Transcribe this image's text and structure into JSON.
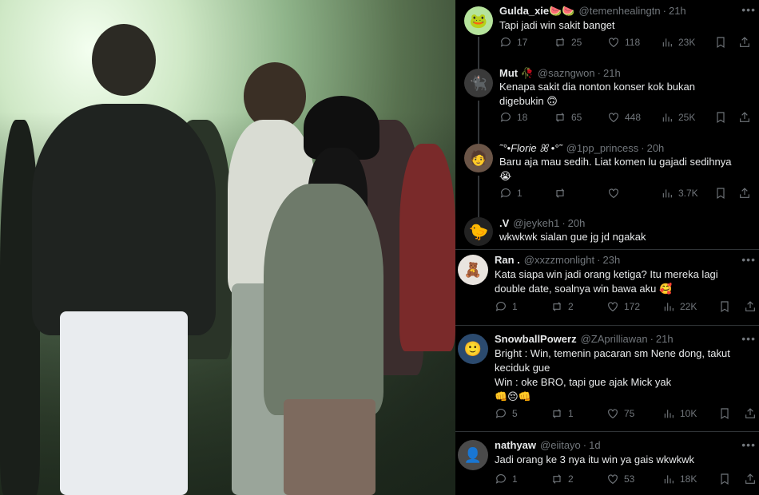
{
  "replies": [
    {
      "name": "Gulda_xie🍉🍉",
      "handle": "@temenhealingtn",
      "time": "21h",
      "text": "Tapi jadi win sakit banget",
      "replies": "17",
      "reposts": "25",
      "likes": "118",
      "views": "23K",
      "avatar_color": "#b5e39b"
    },
    {
      "name": "Mut 🥀",
      "handle": "@sazngwon",
      "time": "21h",
      "text": "Kenapa sakit dia nonton konser kok bukan\ndigebukin 🙃",
      "replies": "18",
      "reposts": "65",
      "likes": "448",
      "views": "25K",
      "avatar_color": "#3a3a3a"
    },
    {
      "name": "˜°•Florie ꕤ •°˜",
      "handle": "@1pp_princess",
      "time": "20h",
      "text": "Baru aja mau sedih. Liat komen lu gajadi sedihnya\n😭",
      "replies": "1",
      "reposts": "",
      "likes": "",
      "views": "3.7K",
      "avatar_color": "#6b5547"
    },
    {
      "name": ".V",
      "handle": "@jeykeh1",
      "time": "20h",
      "text": "wkwkwk sialan gue jg jd ngakak",
      "avatar_color": "#f1c40f"
    },
    {
      "name": "Ran .",
      "handle": "@xxzzmonlight",
      "time": "23h",
      "text": "Kata siapa win jadi orang ketiga? Itu mereka lagi\ndouble date, soalnya win bawa aku 🥰",
      "replies": "1",
      "reposts": "2",
      "likes": "172",
      "views": "22K",
      "avatar_color": "#e9e4df"
    },
    {
      "name": "SnowballPowerz",
      "handle": "@ZAprilliawan",
      "time": "21h",
      "text": "Bright : Win, temenin pacaran sm Nene dong, takut\nkeciduk gue\nWin : oke BRO, tapi gue ajak Mick yak\n👊😔👊",
      "replies": "5",
      "reposts": "1",
      "likes": "75",
      "views": "10K",
      "avatar_color": "#2b4a6e"
    },
    {
      "name": "nathyaw",
      "handle": "@eiitayo",
      "time": "1d",
      "text": "Jadi orang ke 3 nya itu win ya gais wkwkwk",
      "replies": "1",
      "reposts": "2",
      "likes": "53",
      "views": "18K",
      "avatar_color": "#4a4a4a"
    }
  ],
  "icons": {
    "reply": "reply-icon",
    "repost": "repost-icon",
    "like": "heart-icon",
    "views": "views-icon",
    "bookmark": "bookmark-icon",
    "share": "share-icon",
    "more": "more-icon"
  },
  "more_label": "•••",
  "colors": {
    "muted": "#71767b",
    "text": "#e7e9ea",
    "divider": "#2f3336"
  }
}
